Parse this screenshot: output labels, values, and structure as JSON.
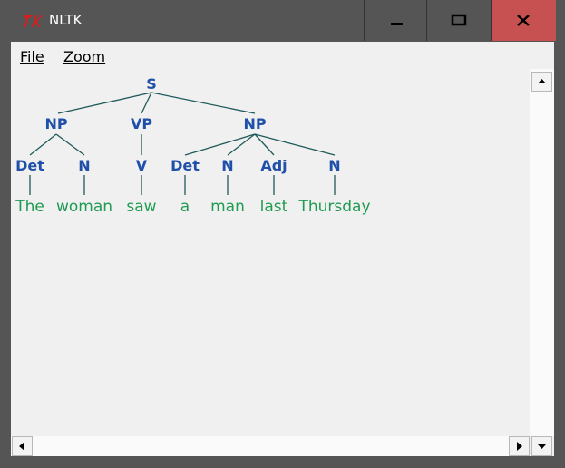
{
  "window": {
    "title": "NLTK"
  },
  "menu": {
    "file_label": "File",
    "zoom_label": "Zoom"
  },
  "tree": {
    "root": "S",
    "constituents": [
      "NP",
      "VP",
      "NP"
    ],
    "pos_tags": [
      "Det",
      "N",
      "V",
      "Det",
      "N",
      "Adj",
      "N"
    ],
    "words": [
      "The",
      "woman",
      "saw",
      "a",
      "man",
      "last",
      "Thursday"
    ]
  },
  "colors": {
    "nonterminal": "#1f4fa8",
    "terminal": "#1e9a52",
    "branch": "#1f5a5a",
    "close_button": "#c75050"
  },
  "icons": {
    "app": "tk-feather-icon",
    "minimize": "minimize-icon",
    "maximize": "maximize-icon",
    "close": "close-icon"
  }
}
